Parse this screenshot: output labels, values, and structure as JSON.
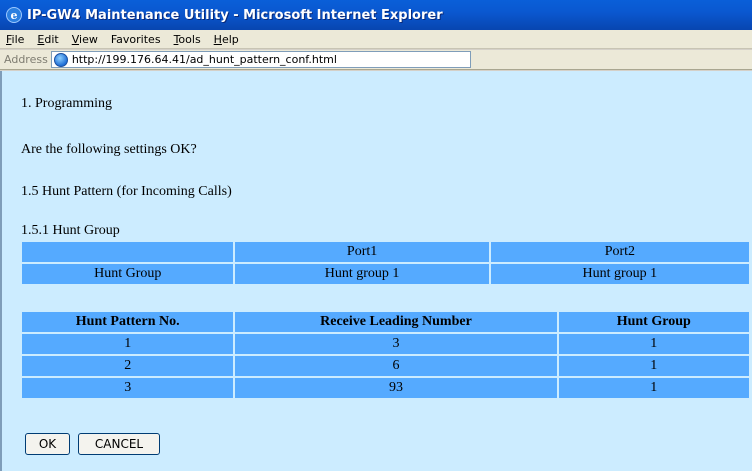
{
  "window": {
    "title": "IP-GW4 Maintenance Utility - Microsoft Internet Explorer"
  },
  "menu": [
    {
      "first": "F",
      "rest": "ile"
    },
    {
      "first": "E",
      "rest": "dit"
    },
    {
      "first": "V",
      "rest": "iew"
    },
    {
      "first": "Favorites",
      "rest": ""
    },
    {
      "first": "T",
      "rest": "ools"
    },
    {
      "first": "H",
      "rest": "elp"
    }
  ],
  "address": {
    "label": "Address",
    "url": "http://199.176.64.41/ad_hunt_pattern_conf.html"
  },
  "page": {
    "heading": "1. Programming",
    "question": "Are the following settings OK?",
    "section": "1.5 Hunt Pattern (for Incoming Calls)",
    "subsection": "1.5.1 Hunt Group"
  },
  "hunt_group_table": {
    "headers": [
      "",
      "Port1",
      "Port2"
    ],
    "row": [
      "Hunt Group",
      "Hunt group 1",
      "Hunt group 1"
    ]
  },
  "pattern_table": {
    "headers": [
      "Hunt Pattern No.",
      "Receive Leading Number",
      "Hunt Group"
    ],
    "rows": [
      [
        "1",
        "3",
        "1"
      ],
      [
        "2",
        "6",
        "1"
      ],
      [
        "3",
        "93",
        "1"
      ]
    ]
  },
  "buttons": {
    "ok": "OK",
    "cancel": "CANCEL"
  }
}
